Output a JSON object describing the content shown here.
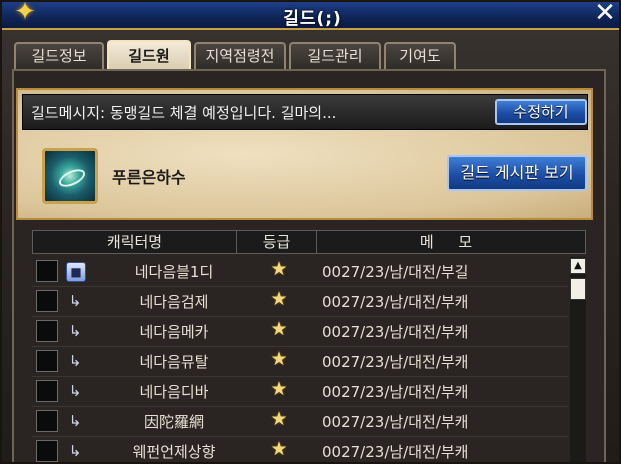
{
  "window": {
    "title": "길드(;)",
    "close_glyph": "✕",
    "logo_icon": "winged-emblem-icon"
  },
  "tabs": [
    {
      "label": "길드정보",
      "active": false
    },
    {
      "label": "길드원",
      "active": true
    },
    {
      "label": "지역점령전",
      "active": false
    },
    {
      "label": "길드관리",
      "active": false
    },
    {
      "label": "기여도",
      "active": false
    }
  ],
  "guild": {
    "message": "길드메시지: 동맹길드 체결 예정입니다. 길마의...",
    "edit_button": "수정하기",
    "name": "푸른은하수",
    "board_button": "길드 게시판 보기"
  },
  "members": {
    "headers": {
      "name": "캐릭터명",
      "grade": "등급",
      "memo": "메 모"
    },
    "rows": [
      {
        "rank_icon": "master-badge-icon",
        "rank_glyph": "■",
        "name": "네다음블1디",
        "grade": "★",
        "memo": "0027/23/남/대전/부길"
      },
      {
        "rank_icon": "member-arrow-icon",
        "rank_glyph": "↳",
        "name": "네다음검제",
        "grade": "★",
        "memo": "0027/23/남/대전/부캐"
      },
      {
        "rank_icon": "member-arrow-icon",
        "rank_glyph": "↳",
        "name": "네다음메카",
        "grade": "★",
        "memo": "0027/23/남/대전/부캐"
      },
      {
        "rank_icon": "member-arrow-icon",
        "rank_glyph": "↳",
        "name": "네다음뮤탈",
        "grade": "★",
        "memo": "0027/23/남/대전/부캐"
      },
      {
        "rank_icon": "member-arrow-icon",
        "rank_glyph": "↳",
        "name": "네다음디바",
        "grade": "★",
        "memo": "0027/23/남/대전/부캐"
      },
      {
        "rank_icon": "member-arrow-icon",
        "rank_glyph": "↳",
        "name": "因陀羅網",
        "grade": "★",
        "memo": "0027/23/남/대전/부캐"
      },
      {
        "rank_icon": "member-arrow-icon",
        "rank_glyph": "↳",
        "name": "웨펀언제상향",
        "grade": "★",
        "memo": "0027/23/남/대전/부캐"
      }
    ]
  },
  "colors": {
    "accent": "#1d4ea7",
    "parchment": "#e6d3ad",
    "frame": "#2a2522",
    "gold": "#caa24c"
  }
}
